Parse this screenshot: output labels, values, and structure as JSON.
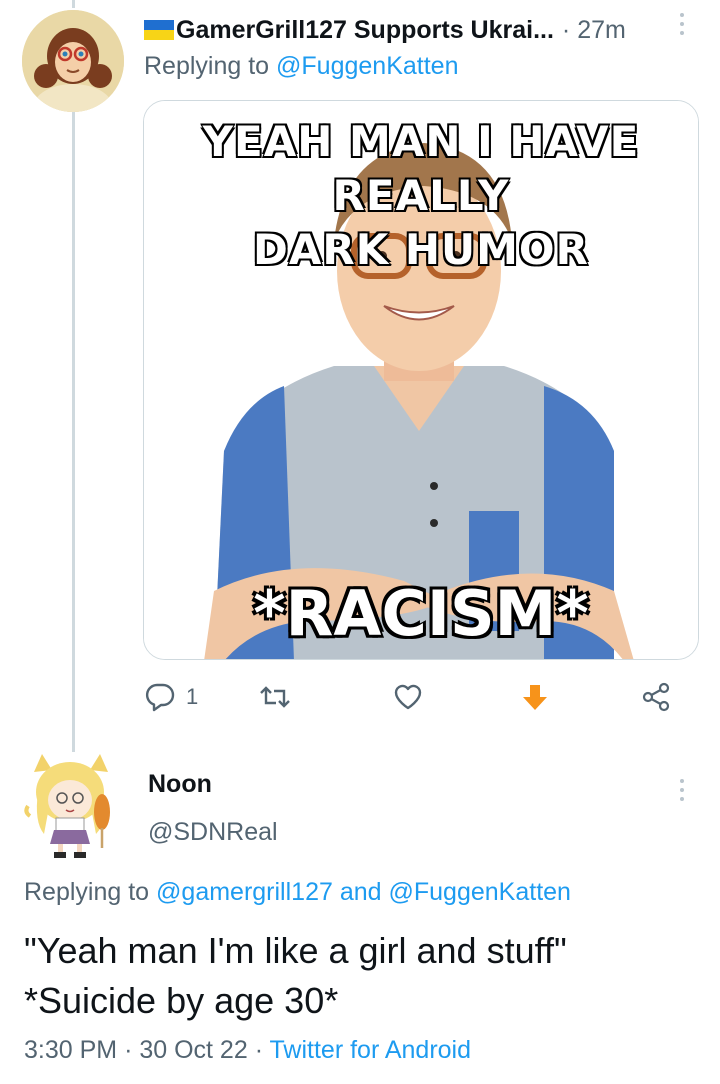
{
  "tweet1": {
    "display_name": "GamerGrill127 Supports Ukrai...",
    "time": "· 27m",
    "replying_prefix": "Replying to",
    "replying_mention": "@FuggenKatten",
    "meme_top_line1": "YEAH MAN I HAVE REALLY",
    "meme_top_line2": "DARK HUMOR",
    "meme_bottom": "*RACISM*",
    "reply_count": "1",
    "icons": [
      "reply-icon",
      "retweet-icon",
      "like-icon",
      "downvote-arrow-icon",
      "share-icon"
    ],
    "colors": {
      "vote_arrow": "#f7931a",
      "link": "#1d9bf0",
      "muted": "#536471"
    }
  },
  "tweet2": {
    "display_name": "Noon",
    "handle": "@SDNReal",
    "replying_prefix": "Replying to",
    "mention_1": "@gamergrill127",
    "conjunction": "and",
    "mention_2": "@FuggenKatten",
    "text_line1": "\"Yeah man I'm like a girl and stuff\"",
    "text_line2": "*Suicide by age 30*",
    "time": "3:30 PM",
    "date": "30 Oct 22",
    "source": "Twitter for Android"
  }
}
